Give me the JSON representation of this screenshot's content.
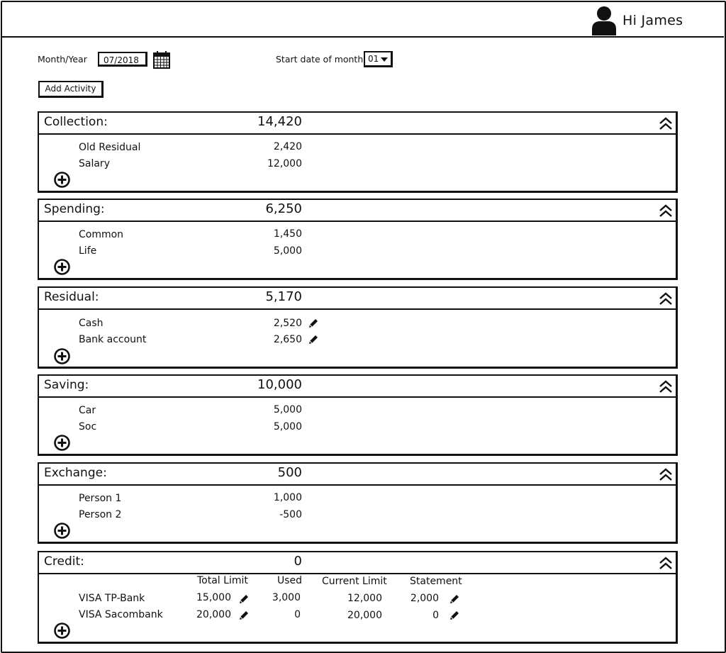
{
  "header": {
    "greeting": "Hi James",
    "avatar_icon": "user-avatar-icon"
  },
  "filters": {
    "month_year_label": "Month/Year",
    "month_year_value": "07/2018",
    "start_date_label": "Start date of month",
    "start_date_value": "01"
  },
  "actions": {
    "add_activity_label": "Add Activity"
  },
  "sections": [
    {
      "title": "Collection:",
      "total": "14,420",
      "items": [
        {
          "label": "Old Residual",
          "value": "2,420"
        },
        {
          "label": "Salary",
          "value": "12,000"
        }
      ]
    },
    {
      "title": "Spending:",
      "total": "6,250",
      "items": [
        {
          "label": "Common",
          "value": "1,450"
        },
        {
          "label": "Life",
          "value": "5,000"
        }
      ]
    },
    {
      "title": "Residual:",
      "total": "5,170",
      "items": [
        {
          "label": "Cash",
          "value": "2,520",
          "editable": true
        },
        {
          "label": "Bank account",
          "value": "2,650",
          "editable": true
        }
      ]
    },
    {
      "title": "Saving:",
      "total": "10,000",
      "items": [
        {
          "label": "Car",
          "value": "5,000"
        },
        {
          "label": "Soc",
          "value": "5,000"
        }
      ]
    },
    {
      "title": "Exchange:",
      "total": "500",
      "items": [
        {
          "label": "Person 1",
          "value": "1,000"
        },
        {
          "label": "Person 2",
          "value": "-500"
        }
      ]
    }
  ],
  "credit": {
    "title": "Credit:",
    "total": "0",
    "columns": [
      "Total Limit",
      "Used",
      "Current Limit",
      "Statement"
    ],
    "rows": [
      {
        "label": "VISA TP-Bank",
        "total_limit": "15,000",
        "used": "3,000",
        "current_limit": "12,000",
        "statement": "2,000"
      },
      {
        "label": "VISA Sacombank",
        "total_limit": "20,000",
        "used": "0",
        "current_limit": "20,000",
        "statement": "0"
      }
    ]
  }
}
